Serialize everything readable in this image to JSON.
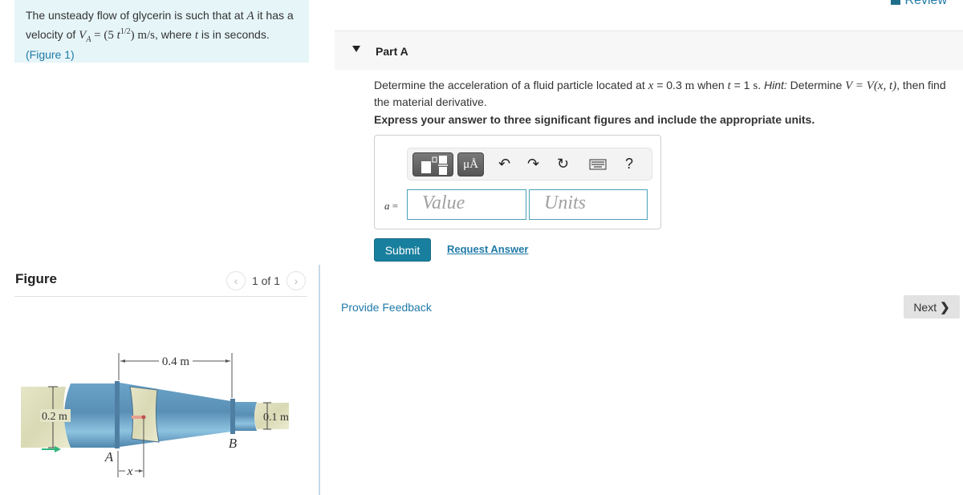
{
  "problem": {
    "text_prefix": "The unsteady flow of glycerin is such that at ",
    "point": "A",
    "text_mid": " it has a velocity of ",
    "velocity_symbol": "V",
    "velocity_subscript": "A",
    "equals": " = (5 ",
    "t_var": "t",
    "exponent": "1/2",
    "unit": ") m/s",
    "text_suffix_1": ", where ",
    "t_var2": "t",
    "text_suffix_2": " is in seconds.",
    "figure_link": "(Figure 1)"
  },
  "figure": {
    "title": "Figure",
    "pager_label": "1 of 1",
    "prev_icon": "chevron-left-icon",
    "next_icon": "chevron-right-icon",
    "labels": {
      "length": "0.4 m",
      "inlet_diameter": "0.2 m",
      "outlet_diameter": "0.1 m",
      "point_a": "A",
      "point_b": "B",
      "position": "x"
    },
    "colors": {
      "pipe": "#5f9cc4",
      "pipe_light": "#8fc0dc",
      "fluid": "#e3e3c4",
      "flow_arrow": "#2eb57a"
    }
  },
  "header": {
    "review_label": "Review",
    "review_icon": "book-icon"
  },
  "part": {
    "title": "Part A",
    "caret_icon": "caret-down-icon",
    "question_1": "Determine the acceleration of a fluid particle located at ",
    "x_var": "x",
    "x_value": " = 0.3 ",
    "x_unit": "m",
    "when": " when ",
    "t_var": "t",
    "t_value": " = 1 ",
    "t_unit": "s",
    "hint_label": "Hint:",
    "hint_text": " Determine ",
    "hint_math": "V = V(x, t)",
    "hint_end": ", then find the material derivative.",
    "instruction": "Express your answer to three significant figures and include the appropriate units."
  },
  "answer": {
    "variable": "a",
    "equals": "=",
    "value_placeholder": "Value",
    "units_placeholder": "Units",
    "toolbar": {
      "templates_icon": "templates-icon",
      "units_label": "μÅ",
      "undo_icon": "undo-icon",
      "redo_icon": "redo-icon",
      "reset_icon": "reset-icon",
      "keyboard_icon": "keyboard-icon",
      "help_label": "?"
    }
  },
  "actions": {
    "submit_label": "Submit",
    "request_answer_label": "Request Answer",
    "feedback_label": "Provide Feedback",
    "next_label": "Next",
    "next_icon": "chevron-right-icon"
  },
  "colors": {
    "accent": "#197f9e",
    "link": "#1f7aa8",
    "problem_bg": "#e6f5f8"
  }
}
